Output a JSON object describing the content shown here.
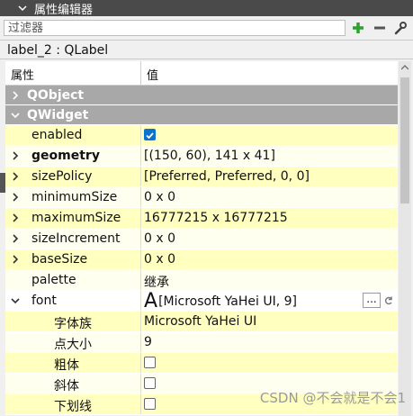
{
  "panel": {
    "title": "属性编辑器"
  },
  "filter": {
    "placeholder": "过滤器"
  },
  "toolbar": {
    "add": "+",
    "remove": "−"
  },
  "object": {
    "label": "label_2 : QLabel"
  },
  "table": {
    "headers": [
      "属性",
      "值"
    ],
    "rows": [
      {
        "kind": "cat",
        "name": "QObject",
        "expand": "collapsed"
      },
      {
        "kind": "cat",
        "name": "QWidget",
        "expand": "expanded"
      },
      {
        "kind": "prop",
        "name": "enabled",
        "value": "",
        "checkbox": true,
        "checked": true,
        "bg": "yellow"
      },
      {
        "kind": "prop",
        "name": "geometry",
        "value": "[(150, 60), 141 x 41]",
        "bold": true,
        "expand": "collapsed",
        "bg": "lyellow"
      },
      {
        "kind": "prop",
        "name": "sizePolicy",
        "value": "[Preferred, Preferred, 0, 0]",
        "expand": "collapsed",
        "bg": "yellow"
      },
      {
        "kind": "prop",
        "name": "minimumSize",
        "value": "0 x 0",
        "expand": "collapsed",
        "bg": "lyellow"
      },
      {
        "kind": "prop",
        "name": "maximumSize",
        "value": "16777215 x 16777215",
        "expand": "collapsed",
        "bg": "yellow"
      },
      {
        "kind": "prop",
        "name": "sizeIncrement",
        "value": "0 x 0",
        "expand": "collapsed",
        "bg": "lyellow"
      },
      {
        "kind": "prop",
        "name": "baseSize",
        "value": "0 x 0",
        "expand": "collapsed",
        "bg": "yellow"
      },
      {
        "kind": "prop",
        "name": "palette",
        "value": "继承",
        "bg": "lyellow"
      },
      {
        "kind": "font",
        "name": "font",
        "value": "[Microsoft YaHei UI, 9]",
        "glyph": "A",
        "expand": "expanded",
        "bg": "white",
        "dots": "..."
      },
      {
        "kind": "sub",
        "name": "字体族",
        "value": "Microsoft YaHei UI",
        "bg": "yellow"
      },
      {
        "kind": "sub",
        "name": "点大小",
        "value": "9",
        "bg": "lyellow"
      },
      {
        "kind": "sub",
        "name": "粗体",
        "value": "",
        "checkbox": true,
        "checked": false,
        "bg": "yellow"
      },
      {
        "kind": "sub",
        "name": "斜体",
        "value": "",
        "checkbox": true,
        "checked": false,
        "bg": "lyellow"
      },
      {
        "kind": "sub",
        "name": "下划线",
        "value": "",
        "checkbox": true,
        "checked": false,
        "bg": "yellow"
      }
    ]
  },
  "watermark": "CSDN @不会就是不会1",
  "colors": {
    "category": "#a8a8a8",
    "rowYellow": "#ffffbf",
    "rowLightYellow": "#fffff0",
    "checkbox": "#0b72cf",
    "addGreen": "#2fa12f"
  }
}
